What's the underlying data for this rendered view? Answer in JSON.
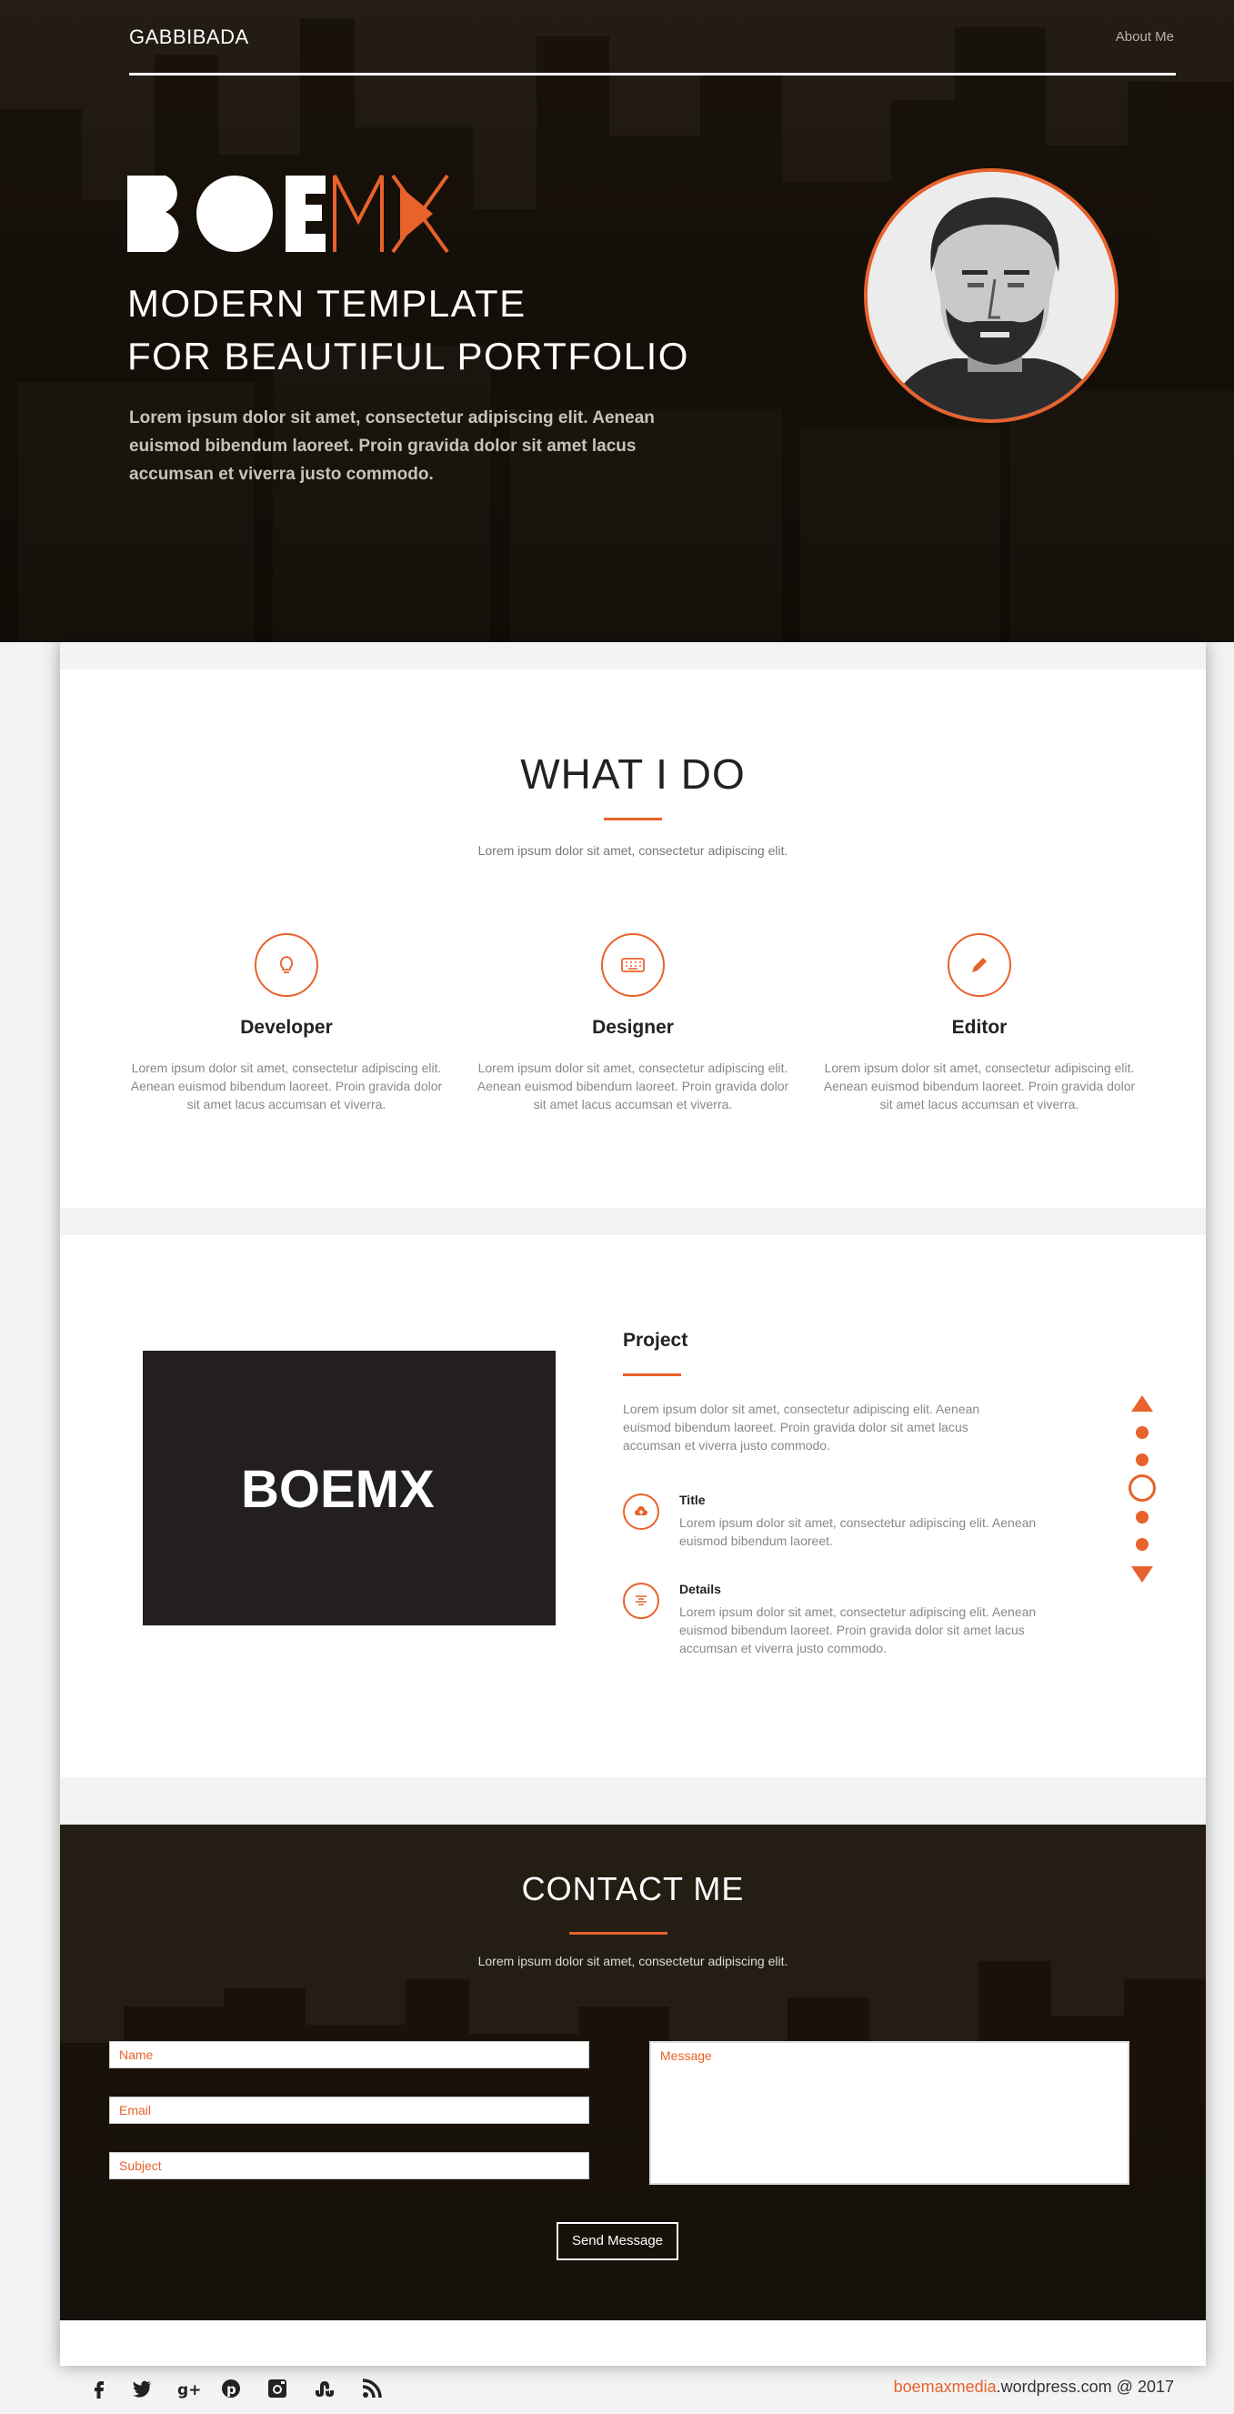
{
  "header": {
    "brand": "GABBIBADA",
    "nav_about": "About Me"
  },
  "hero": {
    "logo_text": "BOEMX",
    "tagline_line1": "MODERN TEMPLATE",
    "tagline_line2": "FOR BEAUTIFUL PORTFOLIO",
    "description": "Lorem ipsum dolor sit amet, consectetur adipiscing elit. Aenean euismod bibendum laoreet. Proin gravida dolor sit amet lacus accumsan et viverra justo commodo."
  },
  "what_i_do": {
    "title": "WHAT I DO",
    "subtitle": "Lorem ipsum dolor sit amet, consectetur adipiscing elit.",
    "services": [
      {
        "icon": "lightbulb-icon",
        "title": "Developer",
        "text": "Lorem ipsum dolor sit amet, consectetur adipiscing elit. Aenean euismod bibendum laoreet. Proin gravida dolor sit amet lacus accumsan et viverra."
      },
      {
        "icon": "keyboard-icon",
        "title": "Designer",
        "text": "Lorem ipsum dolor sit amet, consectetur adipiscing elit. Aenean euismod bibendum laoreet. Proin gravida dolor sit amet lacus accumsan et viverra."
      },
      {
        "icon": "pencil-icon",
        "title": "Editor",
        "text": "Lorem ipsum dolor sit amet, consectetur adipiscing elit. Aenean euismod bibendum laoreet. Proin gravida dolor sit amet lacus accumsan et viverra."
      }
    ]
  },
  "project": {
    "image_logo": "BOEMX",
    "title": "Project",
    "description": "Lorem ipsum dolor sit amet, consectetur adipiscing elit. Aenean euismod bibendum laoreet. Proin gravida dolor sit amet lacus accumsan et viverra justo commodo.",
    "features": [
      {
        "icon": "cloud-upload-icon",
        "title": "Title",
        "text": "Lorem ipsum dolor sit amet, consectetur adipiscing elit. Aenean euismod bibendum laoreet."
      },
      {
        "icon": "align-center-icon",
        "title": "Details",
        "text": "Lorem ipsum dolor sit amet, consectetur adipiscing elit. Aenean euismod bibendum laoreet. Proin gravida dolor sit amet lacus accumsan et viverra justo commodo."
      }
    ],
    "pager_active_index": 3,
    "pager_count": 6
  },
  "contact": {
    "title": "CONTACT ME",
    "subtitle": "Lorem ipsum dolor sit amet, consectetur adipiscing elit.",
    "name_placeholder": "Name",
    "email_placeholder": "Email",
    "subject_placeholder": "Subject",
    "message_placeholder": "Message",
    "send_label": "Send Message"
  },
  "footer": {
    "social": [
      "facebook-icon",
      "twitter-icon",
      "google-plus-icon",
      "pinterest-icon",
      "instagram-icon",
      "stumbleupon-icon",
      "rss-icon"
    ],
    "credit_accent": "boemaxmedia",
    "credit_rest": ".wordpress.com @ 2017"
  },
  "colors": {
    "accent": "#e8622c",
    "dark": "#231f20"
  }
}
